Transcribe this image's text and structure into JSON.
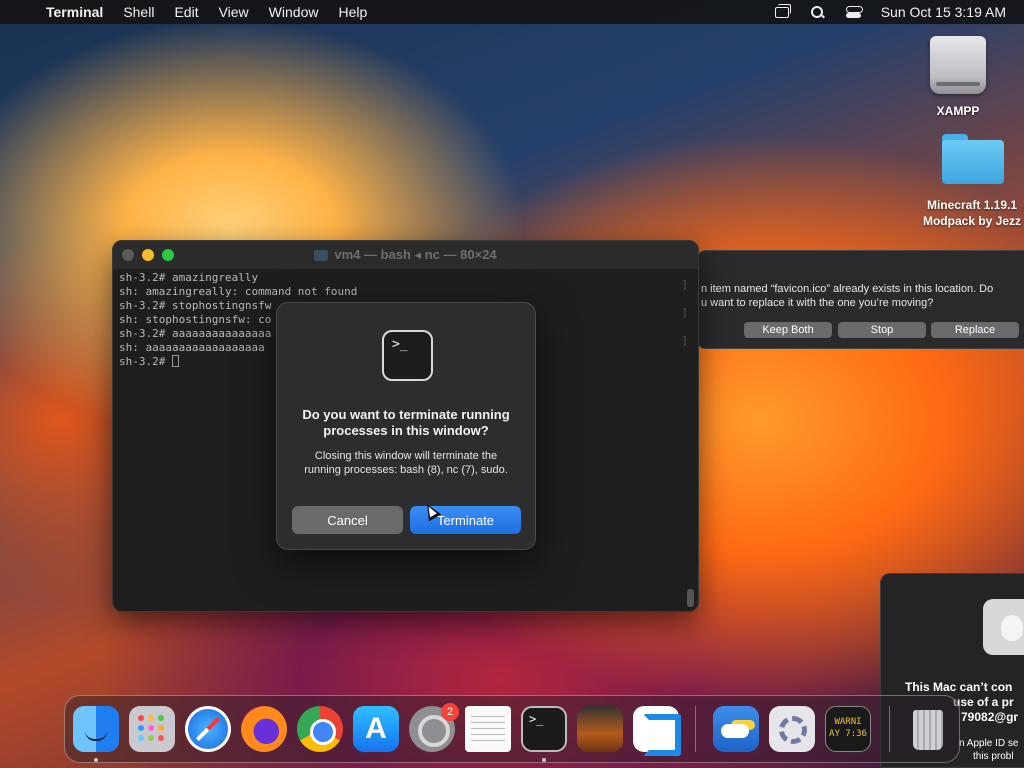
{
  "menubar": {
    "apple_glyph": "",
    "app_name": "Terminal",
    "items": [
      "Shell",
      "Edit",
      "View",
      "Window",
      "Help"
    ],
    "clock": "Sun Oct 15  3:19 AM"
  },
  "desktop": {
    "icons": [
      {
        "label": "XAMPP",
        "icon": "drive-icon"
      },
      {
        "label_line1": "Minecraft 1.19.1",
        "label_line2": "Modpack by Jezz",
        "icon": "folder-icon"
      }
    ]
  },
  "terminal": {
    "title": "vm4 — bash ◂ nc — 80×24",
    "lines": [
      "sh-3.2# amazingreally",
      "sh: amazingreally: command not found",
      "sh-3.2# stophostingnsfw",
      "sh: stophostingnsfw: co",
      "sh-3.2# aaaaaaaaaaaaaaa",
      "sh: aaaaaaaaaaaaaaaaaa",
      "sh-3.2# "
    ]
  },
  "dialog": {
    "icon_glyph": ">_",
    "title": "Do you want to terminate running processes in this window?",
    "message": "Closing this window will terminate the running processes: bash (8), nc (7), sudo.",
    "cancel_label": "Cancel",
    "terminate_label": "Terminate"
  },
  "replace_dialog": {
    "line1": "n item named “favicon.ico” already exists in this location. Do",
    "line2": "u want to replace it with the one you’re moving?",
    "keep_both_label": "Keep Both",
    "stop_label": "Stop",
    "replace_label": "Replace"
  },
  "mac_panel": {
    "title_line1": "This Mac can’t con",
    "title_line2": "use of a pr",
    "title_line3": "79082@gr",
    "sub_line1": "n Apple ID se",
    "sub_line2": "this probl"
  },
  "dock": {
    "sysprefs_badge": "2",
    "console_line1": "WARNI",
    "console_line2": "AY 7:36"
  },
  "colors": {
    "accent": "#1f6fe0",
    "traffic_min": "#f5bd2e",
    "traffic_max": "#2ac840",
    "badge": "#f0443b"
  }
}
